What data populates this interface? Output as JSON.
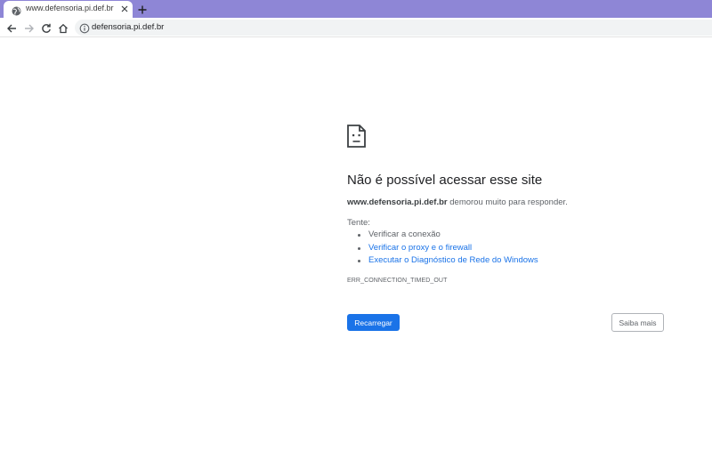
{
  "browser": {
    "tab": {
      "title": "www.defensoria.pi.def.br",
      "icon": "globe-icon"
    },
    "toolbar": {
      "back_icon": "arrow-left-icon",
      "forward_icon": "arrow-right-icon",
      "reload_icon": "reload-icon",
      "home_icon": "home-icon",
      "site_info_icon": "info-icon",
      "url": "defensoria.pi.def.br"
    },
    "colors": {
      "tabstrip": "#8e86d6",
      "accent": "#1a73e8"
    }
  },
  "error_page": {
    "icon": "sad-page-icon",
    "heading": "Não é possível acessar esse site",
    "host": "www.defensoria.pi.def.br",
    "summary_rest": " demorou muito para responder.",
    "try_label": "Tente:",
    "suggestions": [
      {
        "label": "Verificar a conexão",
        "link": false
      },
      {
        "label": "Verificar o proxy e o firewall",
        "link": true
      },
      {
        "label": "Executar o Diagnóstico de Rede do Windows",
        "link": true
      }
    ],
    "error_code": "ERR_CONNECTION_TIMED_OUT",
    "reload_button": "Recarregar",
    "details_button": "Saiba mais"
  }
}
